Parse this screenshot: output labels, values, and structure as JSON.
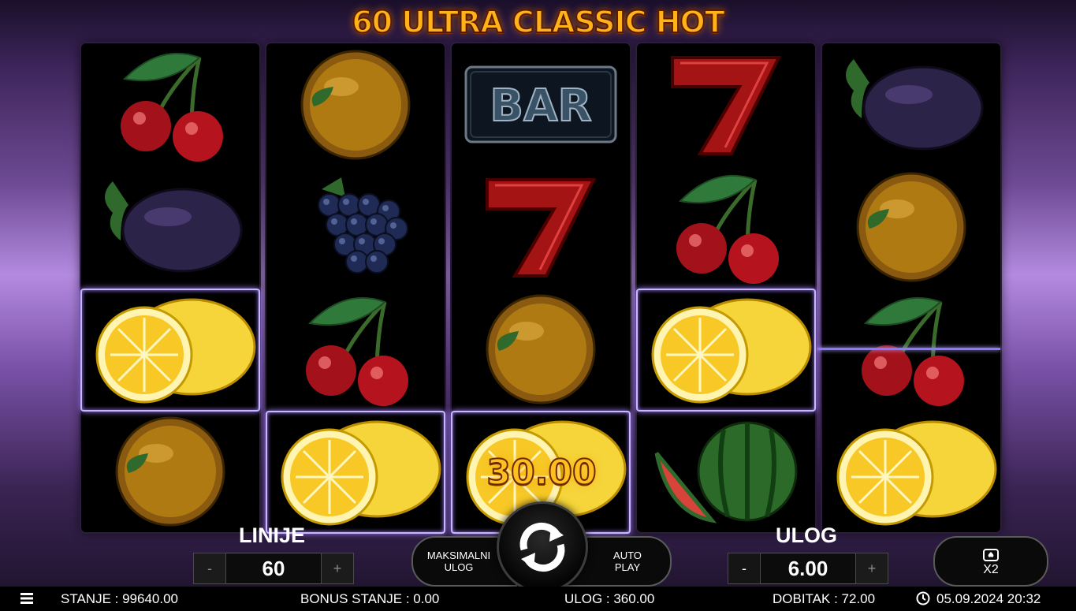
{
  "title": "60 ULTRA CLASSIC HOT",
  "win_amount": "30.00",
  "reels": [
    [
      "cherry",
      "plum",
      "lemon",
      "orange"
    ],
    [
      "orange",
      "grapes",
      "cherry",
      "lemon"
    ],
    [
      "bar",
      "seven",
      "orange",
      "lemon"
    ],
    [
      "seven",
      "cherry",
      "lemon",
      "watermelon"
    ],
    [
      "plum",
      "orange",
      "cherry",
      "lemon"
    ]
  ],
  "bar_text": "BAR",
  "controls": {
    "lines_label": "LINIJE",
    "lines_value": "60",
    "bet_label": "ULOG",
    "bet_value": "6.00",
    "minus": "-",
    "plus": "+",
    "max_bet_label": "MAKSIMALNI\nULOG",
    "auto_play_label": "AUTO\nPLAY",
    "gamble_label": "X2"
  },
  "status": {
    "balance": "STANJE : 99640.00",
    "bonus_balance": "BONUS STANJE : 0.00",
    "total_bet": "ULOG : 360.00",
    "win": "DOBITAK : 72.00",
    "datetime": "05.09.2024 20:32"
  },
  "colors": {
    "accent_gold": "#ffb21a",
    "win_frame": "#c9b6ff",
    "payline": "#8a78ff"
  }
}
